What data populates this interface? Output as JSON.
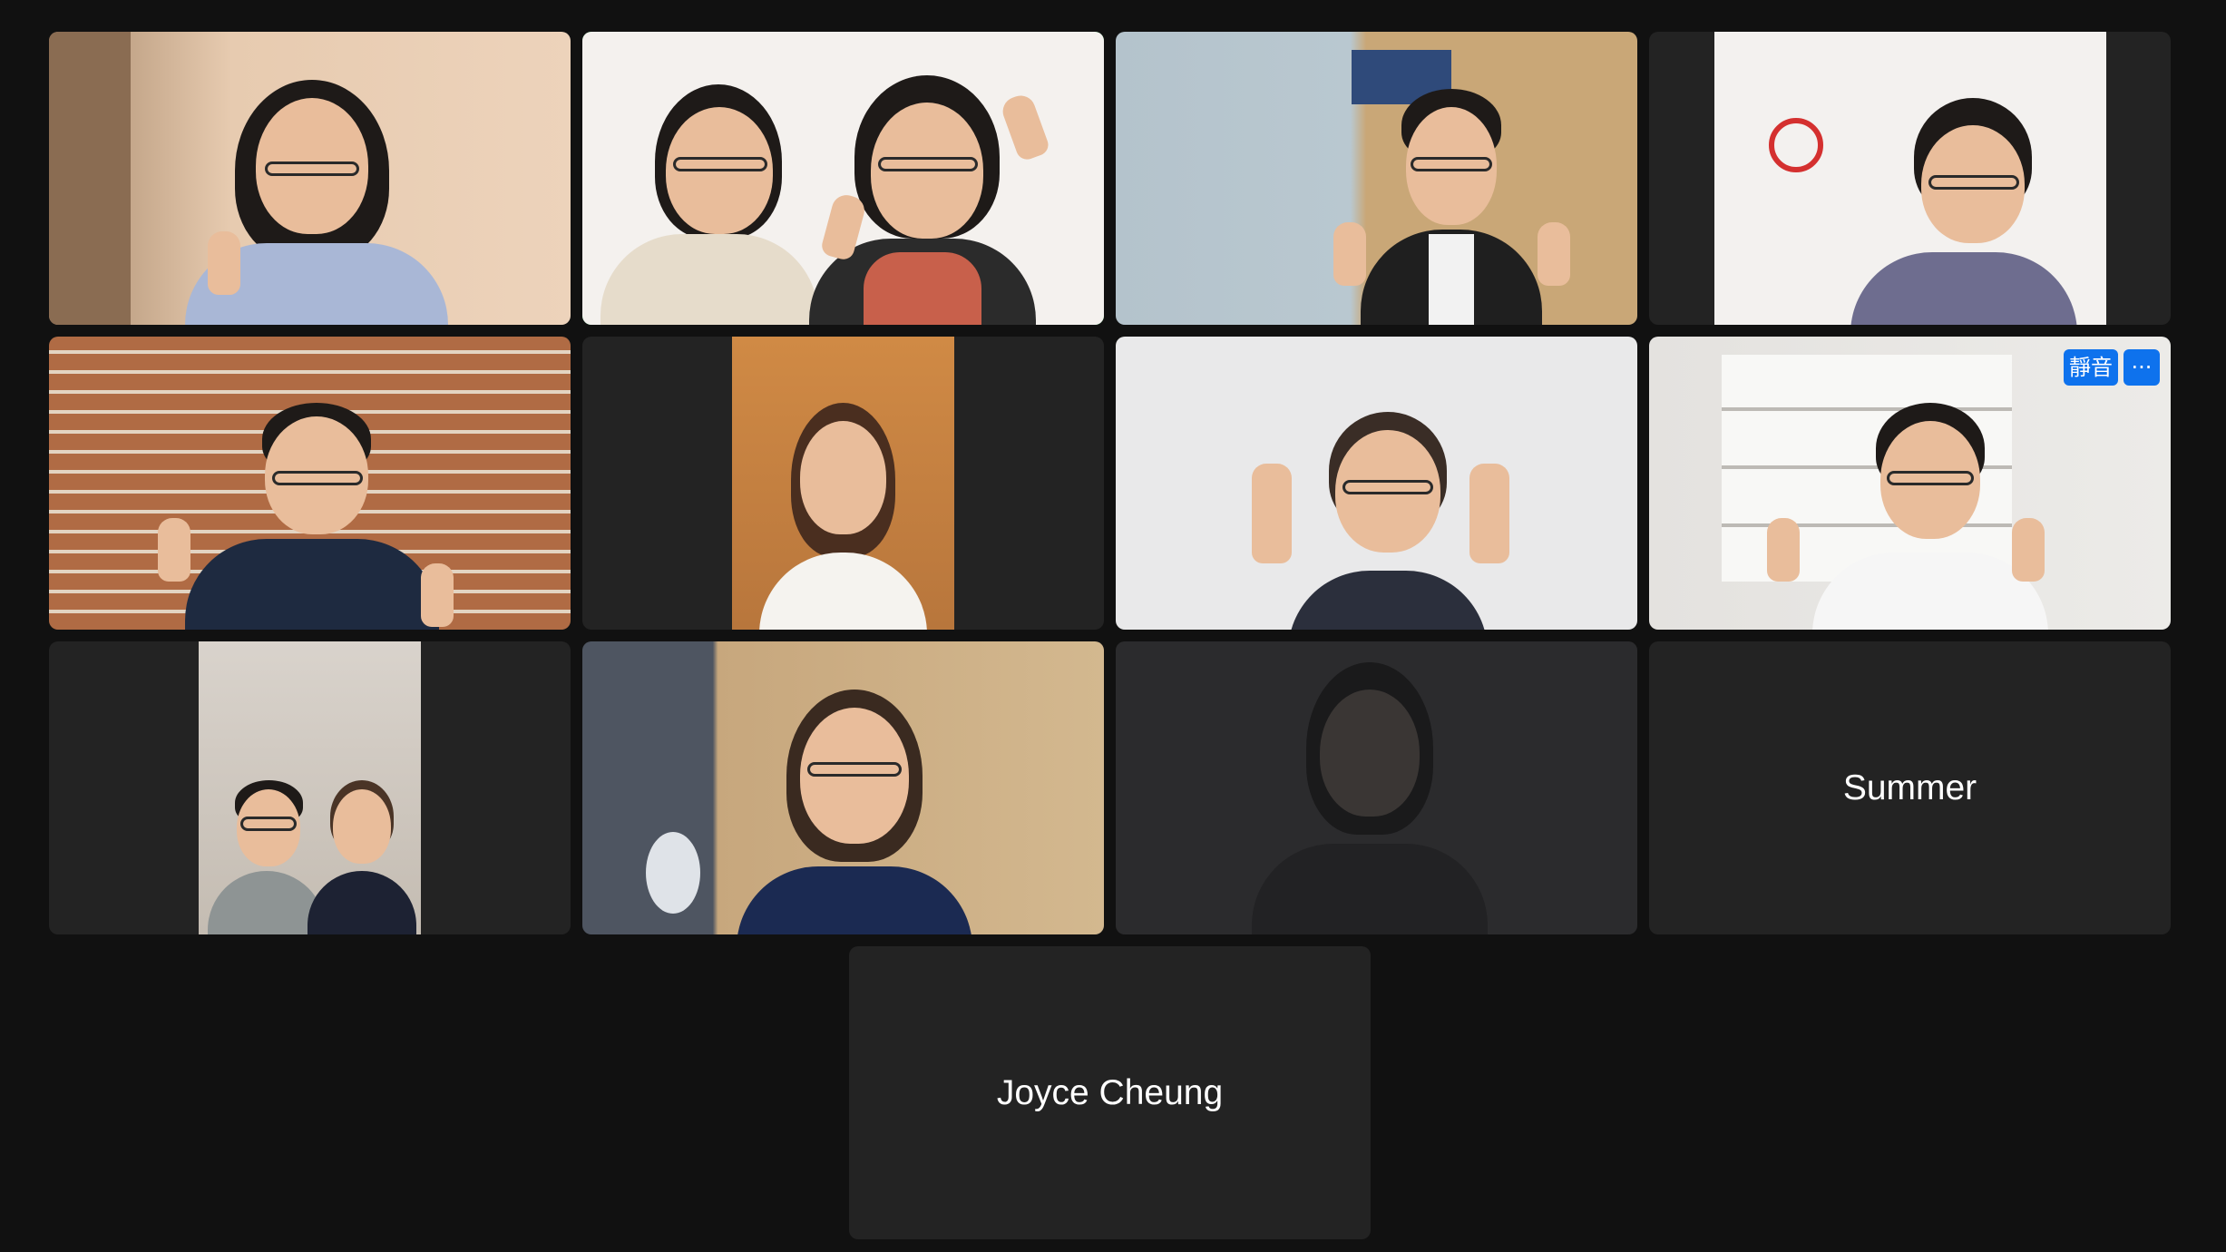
{
  "meeting": {
    "view": "gallery",
    "active_speaker_color": "#23d959"
  },
  "participants": [
    {
      "tile": 1,
      "video_on": true
    },
    {
      "tile": 2,
      "video_on": true,
      "active_speaker": true
    },
    {
      "tile": 3,
      "video_on": true
    },
    {
      "tile": 4,
      "video_on": true
    },
    {
      "tile": 5,
      "video_on": true
    },
    {
      "tile": 6,
      "video_on": true
    },
    {
      "tile": 7,
      "video_on": true
    },
    {
      "tile": 8,
      "video_on": true,
      "hover_controls": {
        "mute_label": "靜音",
        "more_label": "···"
      }
    },
    {
      "tile": 9,
      "video_on": true
    },
    {
      "tile": 10,
      "video_on": true
    },
    {
      "tile": 11,
      "video_on": true
    },
    {
      "tile": 12,
      "video_on": false,
      "name": "Summer"
    },
    {
      "tile": 13,
      "video_on": false,
      "name": "Joyce Cheung"
    }
  ]
}
